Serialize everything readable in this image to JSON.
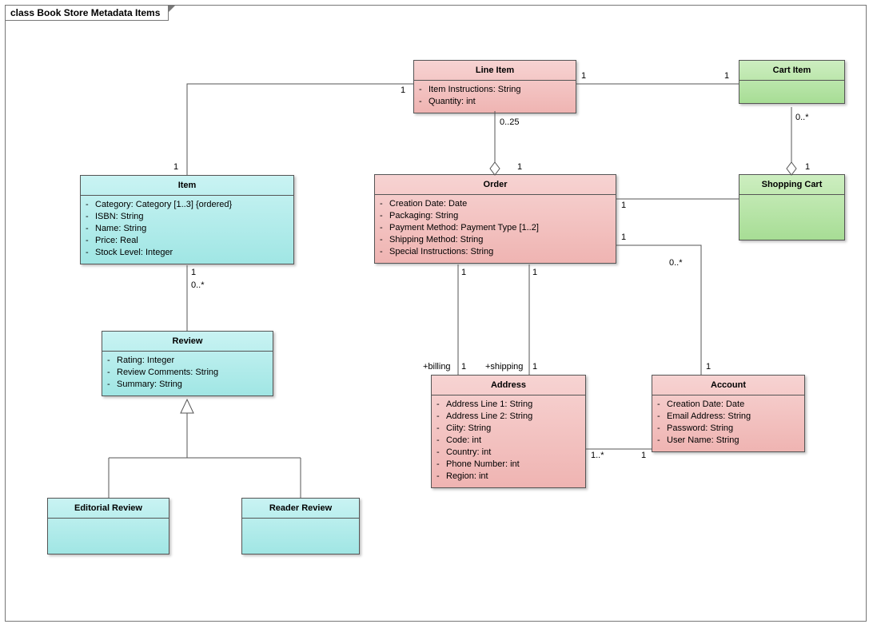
{
  "frame_title": "class Book Store Metadata Items",
  "classes": {
    "line_item": {
      "title": "Line Item",
      "attrs": [
        "Item Instructions: String",
        "Quantity: int"
      ]
    },
    "cart_item": {
      "title": "Cart Item",
      "attrs": []
    },
    "shopping_cart": {
      "title": "Shopping Cart",
      "attrs": []
    },
    "item": {
      "title": "Item",
      "attrs": [
        "Category: Category [1..3] {ordered}",
        "ISBN: String",
        "Name: String",
        "Price: Real",
        "Stock Level: Integer"
      ]
    },
    "order": {
      "title": "Order",
      "attrs": [
        "Creation Date: Date",
        "Packaging: String",
        "Payment Method: Payment Type [1..2]",
        "Shipping Method: String",
        "Special Instructions: String"
      ]
    },
    "review": {
      "title": "Review",
      "attrs": [
        "Rating: Integer",
        "Review Comments: String",
        "Summary: String"
      ]
    },
    "editorial_review": {
      "title": "Editorial Review",
      "attrs": []
    },
    "reader_review": {
      "title": "Reader Review",
      "attrs": []
    },
    "address": {
      "title": "Address",
      "attrs": [
        "Address Line 1: String",
        "Address Line 2: String",
        "Ciity: String",
        "Code: int",
        "Country: int",
        "Phone Number: int",
        "Region: int"
      ]
    },
    "account": {
      "title": "Account",
      "attrs": [
        "Creation Date: Date",
        "Email Address: String",
        "Password: String",
        "User Name: String"
      ]
    }
  },
  "mults": {
    "li_item_top": "1",
    "li_item_bot": "1",
    "li_cart_l": "1",
    "li_cart_r": "1",
    "li_order_top": "0..25",
    "li_order_bot": "1",
    "cart_shop_top": "0..*",
    "cart_shop_bot": "1",
    "item_review_top": "1",
    "item_review_bot": "0..*",
    "order_shop_l": "1",
    "order_account_l": "1",
    "order_account_r": "0..*",
    "order_addr_b_top": "1",
    "order_addr_b_bot": "1",
    "order_addr_b_role": "+billing",
    "order_addr_s_top": "1",
    "order_addr_s_bot": "1",
    "order_addr_s_role": "+shipping",
    "addr_acct_l": "1..*",
    "addr_acct_r": "1"
  },
  "chart_data": {
    "type": "uml-class-diagram",
    "classes": [
      {
        "name": "Line Item",
        "color": "pink",
        "attrs": [
          {
            "vis": "-",
            "sig": "Item Instructions: String"
          },
          {
            "vis": "-",
            "sig": "Quantity: int"
          }
        ]
      },
      {
        "name": "Cart Item",
        "color": "green",
        "attrs": []
      },
      {
        "name": "Shopping Cart",
        "color": "green",
        "attrs": []
      },
      {
        "name": "Item",
        "color": "cyan",
        "attrs": [
          {
            "vis": "-",
            "sig": "Category: Category [1..3] {ordered}"
          },
          {
            "vis": "-",
            "sig": "ISBN: String"
          },
          {
            "vis": "-",
            "sig": "Name: String"
          },
          {
            "vis": "-",
            "sig": "Price: Real"
          },
          {
            "vis": "-",
            "sig": "Stock Level: Integer"
          }
        ]
      },
      {
        "name": "Order",
        "color": "pink",
        "attrs": [
          {
            "vis": "-",
            "sig": "Creation Date: Date"
          },
          {
            "vis": "-",
            "sig": "Packaging: String"
          },
          {
            "vis": "-",
            "sig": "Payment Method: Payment Type [1..2]"
          },
          {
            "vis": "-",
            "sig": "Shipping Method: String"
          },
          {
            "vis": "-",
            "sig": "Special Instructions: String"
          }
        ]
      },
      {
        "name": "Review",
        "color": "cyan",
        "attrs": [
          {
            "vis": "-",
            "sig": "Rating: Integer"
          },
          {
            "vis": "-",
            "sig": "Review Comments: String"
          },
          {
            "vis": "-",
            "sig": "Summary: String"
          }
        ]
      },
      {
        "name": "Editorial Review",
        "color": "cyan",
        "attrs": []
      },
      {
        "name": "Reader Review",
        "color": "cyan",
        "attrs": []
      },
      {
        "name": "Address",
        "color": "pink",
        "attrs": [
          {
            "vis": "-",
            "sig": "Address Line 1: String"
          },
          {
            "vis": "-",
            "sig": "Address Line 2: String"
          },
          {
            "vis": "-",
            "sig": "Ciity: String"
          },
          {
            "vis": "-",
            "sig": "Code: int"
          },
          {
            "vis": "-",
            "sig": "Country: int"
          },
          {
            "vis": "-",
            "sig": "Phone Number: int"
          },
          {
            "vis": "-",
            "sig": "Region: int"
          }
        ]
      },
      {
        "name": "Account",
        "color": "pink",
        "attrs": [
          {
            "vis": "-",
            "sig": "Creation Date: Date"
          },
          {
            "vis": "-",
            "sig": "Email Address: String"
          },
          {
            "vis": "-",
            "sig": "Password: String"
          },
          {
            "vis": "-",
            "sig": "User Name: String"
          }
        ]
      }
    ],
    "relations": [
      {
        "from": "Line Item",
        "to": "Item",
        "type": "association",
        "from_mult": "1",
        "to_mult": "1"
      },
      {
        "from": "Line Item",
        "to": "Cart Item",
        "type": "association",
        "from_mult": "1",
        "to_mult": "1"
      },
      {
        "from": "Order",
        "to": "Line Item",
        "type": "aggregation",
        "aggregate_end": "Order",
        "from_mult": "1",
        "to_mult": "0..25"
      },
      {
        "from": "Shopping Cart",
        "to": "Cart Item",
        "type": "aggregation",
        "aggregate_end": "Shopping Cart",
        "from_mult": "1",
        "to_mult": "0..*"
      },
      {
        "from": "Item",
        "to": "Review",
        "type": "association",
        "from_mult": "1",
        "to_mult": "0..*"
      },
      {
        "from": "Review",
        "to": "Editorial Review",
        "type": "generalization",
        "parent": "Review"
      },
      {
        "from": "Review",
        "to": "Reader Review",
        "type": "generalization",
        "parent": "Review"
      },
      {
        "from": "Order",
        "to": "Shopping Cart",
        "type": "association",
        "from_mult": "1",
        "to_mult": ""
      },
      {
        "from": "Order",
        "to": "Account",
        "type": "association",
        "from_mult": "1",
        "to_mult": "0..*"
      },
      {
        "from": "Order",
        "to": "Address",
        "type": "association",
        "role": "+billing",
        "from_mult": "1",
        "to_mult": "1"
      },
      {
        "from": "Order",
        "to": "Address",
        "type": "association",
        "role": "+shipping",
        "from_mult": "1",
        "to_mult": "1"
      },
      {
        "from": "Address",
        "to": "Account",
        "type": "association",
        "from_mult": "1..*",
        "to_mult": "1"
      }
    ]
  }
}
